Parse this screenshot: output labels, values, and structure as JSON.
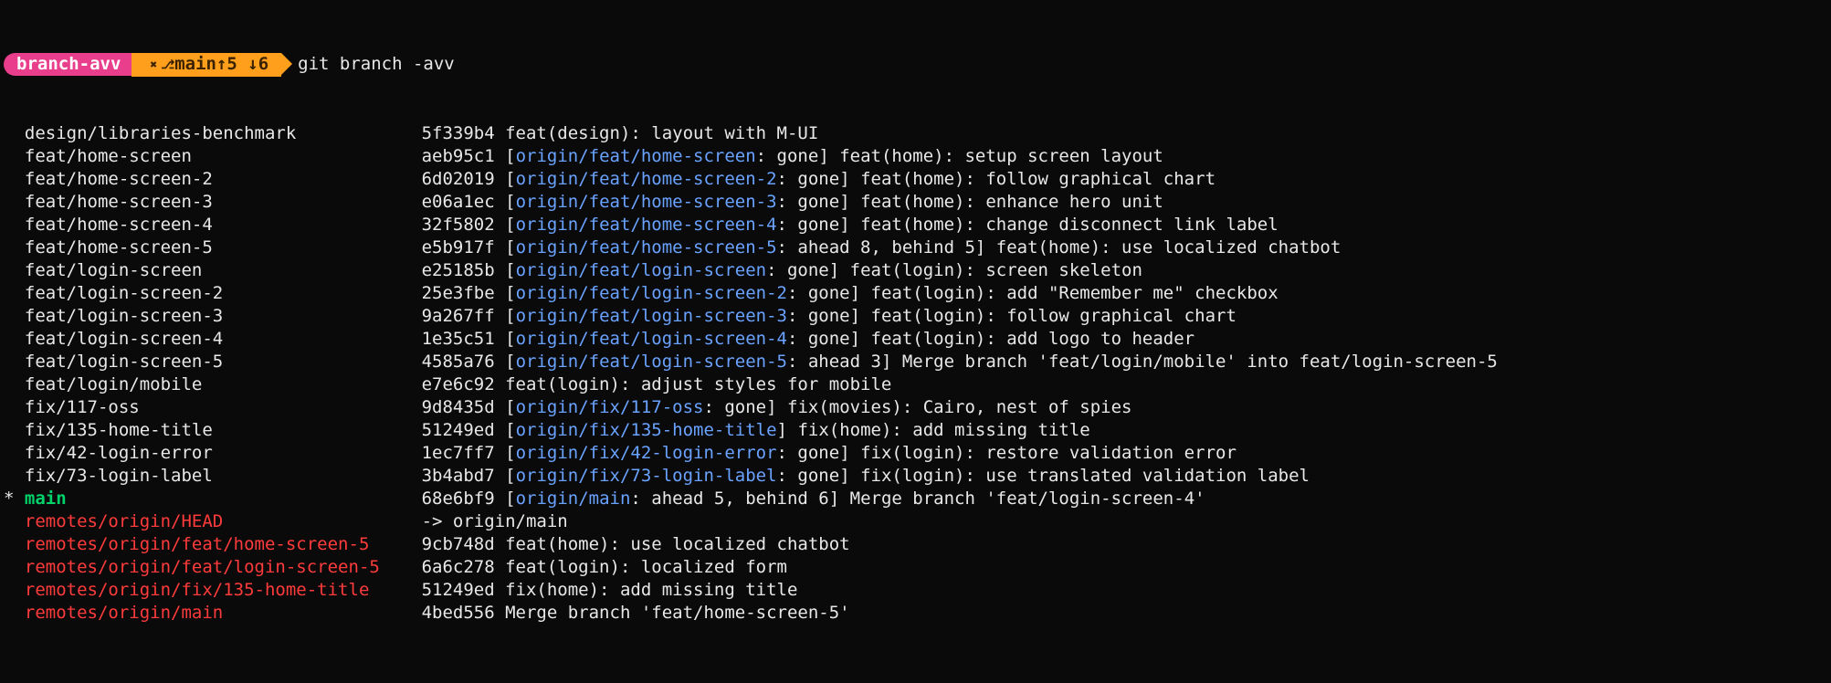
{
  "prompt": {
    "dir_label": "branch-avv",
    "git_icon": "✖",
    "git_branch_glyph": "⎇",
    "git_status": "main↑5 ↓6",
    "command": "git branch -avv"
  },
  "name_col_width": 38,
  "rows": [
    {
      "marker": "  ",
      "name": "design/libraries-benchmark",
      "name_class": "branch-local",
      "sha": "5f339b4",
      "sha_class": "hash-plain",
      "upstream": "",
      "status": "",
      "msg": "feat(design): layout with M-UI"
    },
    {
      "marker": "  ",
      "name": "feat/home-screen",
      "name_class": "branch-local",
      "sha": "aeb95c1",
      "sha_class": "hash-plain",
      "upstream": "origin/feat/home-screen",
      "status": ": gone",
      "msg": "feat(home): setup screen layout"
    },
    {
      "marker": "  ",
      "name": "feat/home-screen-2",
      "name_class": "branch-local",
      "sha": "6d02019",
      "sha_class": "hash-plain",
      "upstream": "origin/feat/home-screen-2",
      "status": ": gone",
      "msg": "feat(home): follow graphical chart"
    },
    {
      "marker": "  ",
      "name": "feat/home-screen-3",
      "name_class": "branch-local",
      "sha": "e06a1ec",
      "sha_class": "hash-plain",
      "upstream": "origin/feat/home-screen-3",
      "status": ": gone",
      "msg": "feat(home): enhance hero unit"
    },
    {
      "marker": "  ",
      "name": "feat/home-screen-4",
      "name_class": "branch-local",
      "sha": "32f5802",
      "sha_class": "hash-plain",
      "upstream": "origin/feat/home-screen-4",
      "status": ": gone",
      "msg": "feat(home): change disconnect link label"
    },
    {
      "marker": "  ",
      "name": "feat/home-screen-5",
      "name_class": "branch-local",
      "sha": "e5b917f",
      "sha_class": "hash-plain",
      "upstream": "origin/feat/home-screen-5",
      "status": ": ahead 8, behind 5",
      "msg": "feat(home): use localized chatbot"
    },
    {
      "marker": "  ",
      "name": "feat/login-screen",
      "name_class": "branch-local",
      "sha": "e25185b",
      "sha_class": "hash-plain",
      "upstream": "origin/feat/login-screen",
      "status": ": gone",
      "msg": "feat(login): screen skeleton"
    },
    {
      "marker": "  ",
      "name": "feat/login-screen-2",
      "name_class": "branch-local",
      "sha": "25e3fbe",
      "sha_class": "hash-plain",
      "upstream": "origin/feat/login-screen-2",
      "status": ": gone",
      "msg": "feat(login): add \"Remember me\" checkbox"
    },
    {
      "marker": "  ",
      "name": "feat/login-screen-3",
      "name_class": "branch-local",
      "sha": "9a267ff",
      "sha_class": "hash-plain",
      "upstream": "origin/feat/login-screen-3",
      "status": ": gone",
      "msg": "feat(login): follow graphical chart"
    },
    {
      "marker": "  ",
      "name": "feat/login-screen-4",
      "name_class": "branch-local",
      "sha": "1e35c51",
      "sha_class": "hash-plain",
      "upstream": "origin/feat/login-screen-4",
      "status": ": gone",
      "msg": "feat(login): add logo to header"
    },
    {
      "marker": "  ",
      "name": "feat/login-screen-5",
      "name_class": "branch-local",
      "sha": "4585a76",
      "sha_class": "hash-plain",
      "upstream": "origin/feat/login-screen-5",
      "status": ": ahead 3",
      "msg": "Merge branch 'feat/login/mobile' into feat/login-screen-5"
    },
    {
      "marker": "  ",
      "name": "feat/login/mobile",
      "name_class": "branch-local",
      "sha": "e7e6c92",
      "sha_class": "hash-plain",
      "upstream": "",
      "status": "",
      "msg": "feat(login): adjust styles for mobile"
    },
    {
      "marker": "  ",
      "name": "fix/117-oss",
      "name_class": "branch-local",
      "sha": "9d8435d",
      "sha_class": "hash-plain",
      "upstream": "origin/fix/117-oss",
      "status": ": gone",
      "msg": "fix(movies): Cairo, nest of spies"
    },
    {
      "marker": "  ",
      "name": "fix/135-home-title",
      "name_class": "branch-local",
      "sha": "51249ed",
      "sha_class": "hash-plain",
      "upstream": "origin/fix/135-home-title",
      "status": "",
      "msg": "fix(home): add missing title"
    },
    {
      "marker": "  ",
      "name": "fix/42-login-error",
      "name_class": "branch-local",
      "sha": "1ec7ff7",
      "sha_class": "hash-plain",
      "upstream": "origin/fix/42-login-error",
      "status": ": gone",
      "msg": "fix(login): restore validation error"
    },
    {
      "marker": "  ",
      "name": "fix/73-login-label",
      "name_class": "branch-local",
      "sha": "3b4abd7",
      "sha_class": "hash-plain",
      "upstream": "origin/fix/73-login-label",
      "status": ": gone",
      "msg": "fix(login): use translated validation label"
    },
    {
      "marker": "* ",
      "name": "main",
      "name_class": "branch-current",
      "sha": "68e6bf9",
      "sha_class": "hash-plain",
      "upstream": "origin/main",
      "status": ": ahead 5, behind 6",
      "msg": "Merge branch 'feat/login-screen-4'"
    },
    {
      "marker": "  ",
      "name": "remotes/origin/HEAD",
      "name_class": "branch-remote",
      "sha": "",
      "sha_class": "hash-plain",
      "upstream": "",
      "status": "",
      "msg": "",
      "arrow": "-> origin/main"
    },
    {
      "marker": "  ",
      "name": "remotes/origin/feat/home-screen-5",
      "name_class": "branch-remote",
      "sha": "9cb748d",
      "sha_class": "hash-plain",
      "upstream": "",
      "status": "",
      "msg": "feat(home): use localized chatbot"
    },
    {
      "marker": "  ",
      "name": "remotes/origin/feat/login-screen-5",
      "name_class": "branch-remote",
      "sha": "6a6c278",
      "sha_class": "hash-plain",
      "upstream": "",
      "status": "",
      "msg": "feat(login): localized form"
    },
    {
      "marker": "  ",
      "name": "remotes/origin/fix/135-home-title",
      "name_class": "branch-remote",
      "sha": "51249ed",
      "sha_class": "hash-plain",
      "upstream": "",
      "status": "",
      "msg": "fix(home): add missing title"
    },
    {
      "marker": "  ",
      "name": "remotes/origin/main",
      "name_class": "branch-remote",
      "sha": "4bed556",
      "sha_class": "hash-plain",
      "upstream": "",
      "status": "",
      "msg": "Merge branch 'feat/home-screen-5'"
    }
  ]
}
